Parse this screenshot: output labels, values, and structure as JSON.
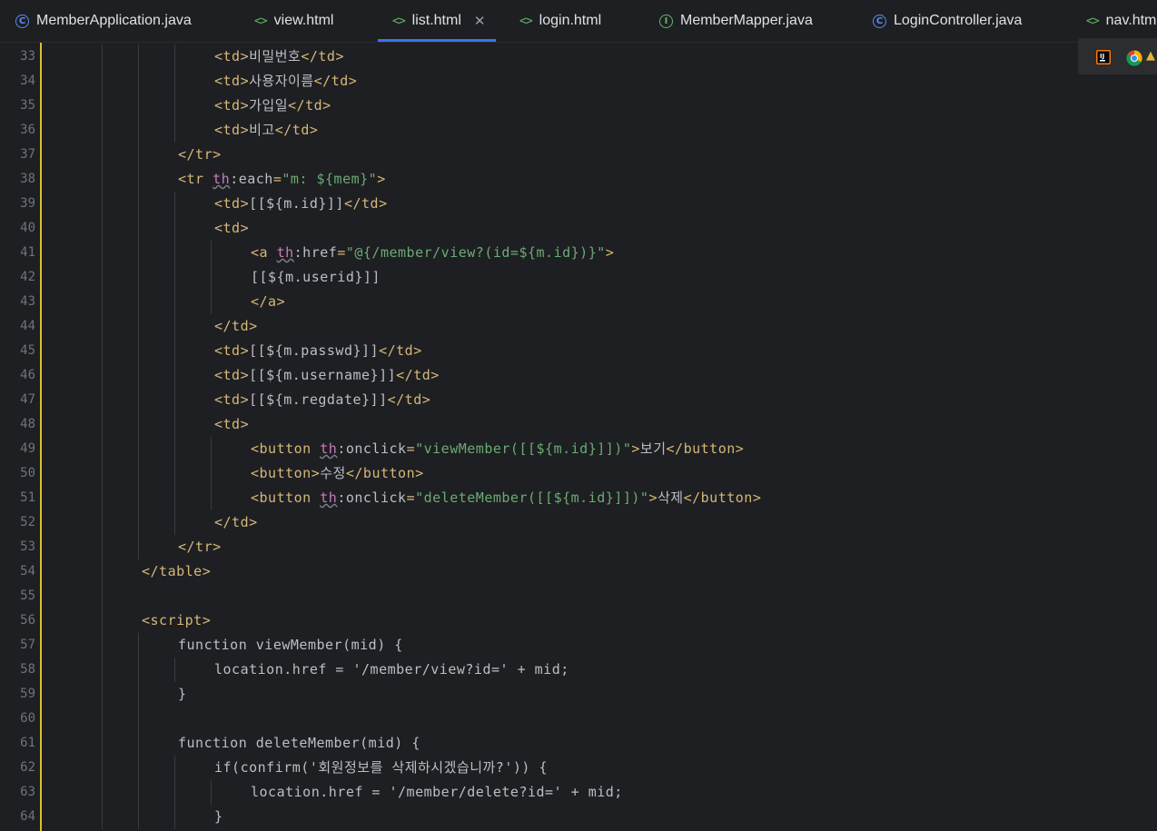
{
  "tabs": [
    {
      "label": "MemberApplication.java",
      "icon": "class-icon"
    },
    {
      "label": "view.html",
      "icon": "html-icon"
    },
    {
      "label": "list.html",
      "icon": "html-icon",
      "active": true
    },
    {
      "label": "login.html",
      "icon": "html-icon"
    },
    {
      "label": "MemberMapper.java",
      "icon": "interface-icon"
    },
    {
      "label": "LoginController.java",
      "icon": "class-icon"
    },
    {
      "label": "nav.htm",
      "icon": "html-icon"
    }
  ],
  "colors": {
    "tag": "#d5b778",
    "attr": "#c77dbb",
    "string": "#6aab73",
    "plain": "#bcbec4",
    "accent": "#3574f0"
  },
  "code": {
    "first_line": 33,
    "lines": [
      {
        "indent": 4,
        "tokens": [
          [
            "tag",
            "<td>"
          ],
          [
            "plain",
            "비밀번호"
          ],
          [
            "tag",
            "</td>"
          ]
        ]
      },
      {
        "indent": 4,
        "tokens": [
          [
            "tag",
            "<td>"
          ],
          [
            "plain",
            "사용자이름"
          ],
          [
            "tag",
            "</td>"
          ]
        ]
      },
      {
        "indent": 4,
        "tokens": [
          [
            "tag",
            "<td>"
          ],
          [
            "plain",
            "가입일"
          ],
          [
            "tag",
            "</td>"
          ]
        ]
      },
      {
        "indent": 4,
        "tokens": [
          [
            "tag",
            "<td>"
          ],
          [
            "plain",
            "비고"
          ],
          [
            "tag",
            "</td>"
          ]
        ]
      },
      {
        "indent": 3,
        "tokens": [
          [
            "tag",
            "</tr>"
          ]
        ]
      },
      {
        "indent": 3,
        "tokens": [
          [
            "tag",
            "<tr "
          ],
          [
            "attr",
            "th"
          ],
          [
            "plain",
            ":each"
          ],
          [
            "tag",
            "="
          ],
          [
            "string",
            "\"m: ${mem}\""
          ],
          [
            "tag",
            ">"
          ]
        ]
      },
      {
        "indent": 4,
        "tokens": [
          [
            "tag",
            "<td>"
          ],
          [
            "plain",
            "[[${m.id}]]"
          ],
          [
            "tag",
            "</td>"
          ]
        ]
      },
      {
        "indent": 4,
        "tokens": [
          [
            "tag",
            "<td>"
          ]
        ]
      },
      {
        "indent": 5,
        "tokens": [
          [
            "tag",
            "<a "
          ],
          [
            "attr",
            "th"
          ],
          [
            "plain",
            ":href"
          ],
          [
            "tag",
            "="
          ],
          [
            "string",
            "\"@{/member/view?(id=${m.id})}\""
          ],
          [
            "tag",
            ">"
          ]
        ]
      },
      {
        "indent": 5,
        "tokens": [
          [
            "plain",
            "[[${m.userid}]]"
          ]
        ]
      },
      {
        "indent": 5,
        "tokens": [
          [
            "tag",
            "</a>"
          ]
        ]
      },
      {
        "indent": 4,
        "tokens": [
          [
            "tag",
            "</td>"
          ]
        ]
      },
      {
        "indent": 4,
        "tokens": [
          [
            "tag",
            "<td>"
          ],
          [
            "plain",
            "[[${m.passwd}]]"
          ],
          [
            "tag",
            "</td>"
          ]
        ]
      },
      {
        "indent": 4,
        "tokens": [
          [
            "tag",
            "<td>"
          ],
          [
            "plain",
            "[[${m.username}]]"
          ],
          [
            "tag",
            "</td>"
          ]
        ]
      },
      {
        "indent": 4,
        "tokens": [
          [
            "tag",
            "<td>"
          ],
          [
            "plain",
            "[[${m.regdate}]]"
          ],
          [
            "tag",
            "</td>"
          ]
        ]
      },
      {
        "indent": 4,
        "tokens": [
          [
            "tag",
            "<td>"
          ]
        ]
      },
      {
        "indent": 5,
        "tokens": [
          [
            "tag",
            "<button "
          ],
          [
            "attr",
            "th"
          ],
          [
            "plain",
            ":onclick"
          ],
          [
            "tag",
            "="
          ],
          [
            "string",
            "\"viewMember([[${m.id}]])\""
          ],
          [
            "tag",
            ">"
          ],
          [
            "plain",
            "보기"
          ],
          [
            "tag",
            "</button>"
          ]
        ]
      },
      {
        "indent": 5,
        "tokens": [
          [
            "tag",
            "<button>"
          ],
          [
            "plain",
            "수정"
          ],
          [
            "tag",
            "</button>"
          ]
        ]
      },
      {
        "indent": 5,
        "tokens": [
          [
            "tag",
            "<button "
          ],
          [
            "attr",
            "th"
          ],
          [
            "plain",
            ":onclick"
          ],
          [
            "tag",
            "="
          ],
          [
            "string",
            "\"deleteMember([[${m.id}]])\""
          ],
          [
            "tag",
            ">"
          ],
          [
            "plain",
            "삭제"
          ],
          [
            "tag",
            "</button>"
          ]
        ]
      },
      {
        "indent": 4,
        "tokens": [
          [
            "tag",
            "</td>"
          ]
        ]
      },
      {
        "indent": 3,
        "tokens": [
          [
            "tag",
            "</tr>"
          ]
        ]
      },
      {
        "indent": 2,
        "tokens": [
          [
            "tag",
            "</table>"
          ]
        ]
      },
      {
        "indent": 0,
        "tokens": []
      },
      {
        "indent": 2,
        "tokens": [
          [
            "tag",
            "<script>"
          ]
        ]
      },
      {
        "indent": 3,
        "tokens": [
          [
            "plain",
            "function viewMember(mid) {"
          ]
        ]
      },
      {
        "indent": 4,
        "tokens": [
          [
            "plain",
            "location.href = '/member/view?id=' + mid;"
          ]
        ]
      },
      {
        "indent": 3,
        "tokens": [
          [
            "plain",
            "}"
          ]
        ]
      },
      {
        "indent": 0,
        "tokens": []
      },
      {
        "indent": 3,
        "tokens": [
          [
            "plain",
            "function deleteMember(mid) {"
          ]
        ]
      },
      {
        "indent": 4,
        "tokens": [
          [
            "plain",
            "if(confirm('회원정보를 삭제하시겠습니까?')) {"
          ]
        ]
      },
      {
        "indent": 5,
        "tokens": [
          [
            "plain",
            "location.href = '/member/delete?id=' + mid;"
          ]
        ]
      },
      {
        "indent": 4,
        "tokens": [
          [
            "plain",
            "}"
          ]
        ]
      }
    ]
  }
}
